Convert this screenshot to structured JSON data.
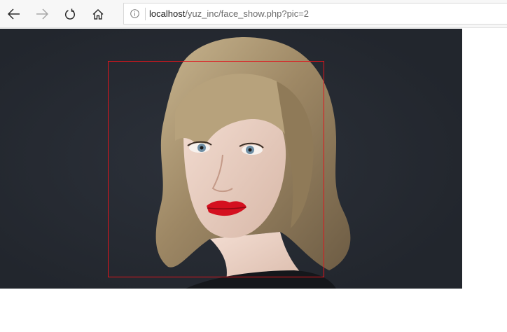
{
  "browser": {
    "nav": {
      "back_icon": "arrow-left-icon",
      "forward_icon": "arrow-right-icon",
      "refresh_icon": "refresh-icon",
      "home_icon": "home-icon",
      "forward_enabled": false
    },
    "address_bar": {
      "info_icon": "info-circle-icon",
      "host": "localhost",
      "path": "/yuz_inc/face_show.php?pic=2"
    }
  },
  "page": {
    "image": {
      "subject": "portrait-photo",
      "background_color": "#262b33"
    },
    "face_detection_box": {
      "color": "#e0141c"
    }
  }
}
